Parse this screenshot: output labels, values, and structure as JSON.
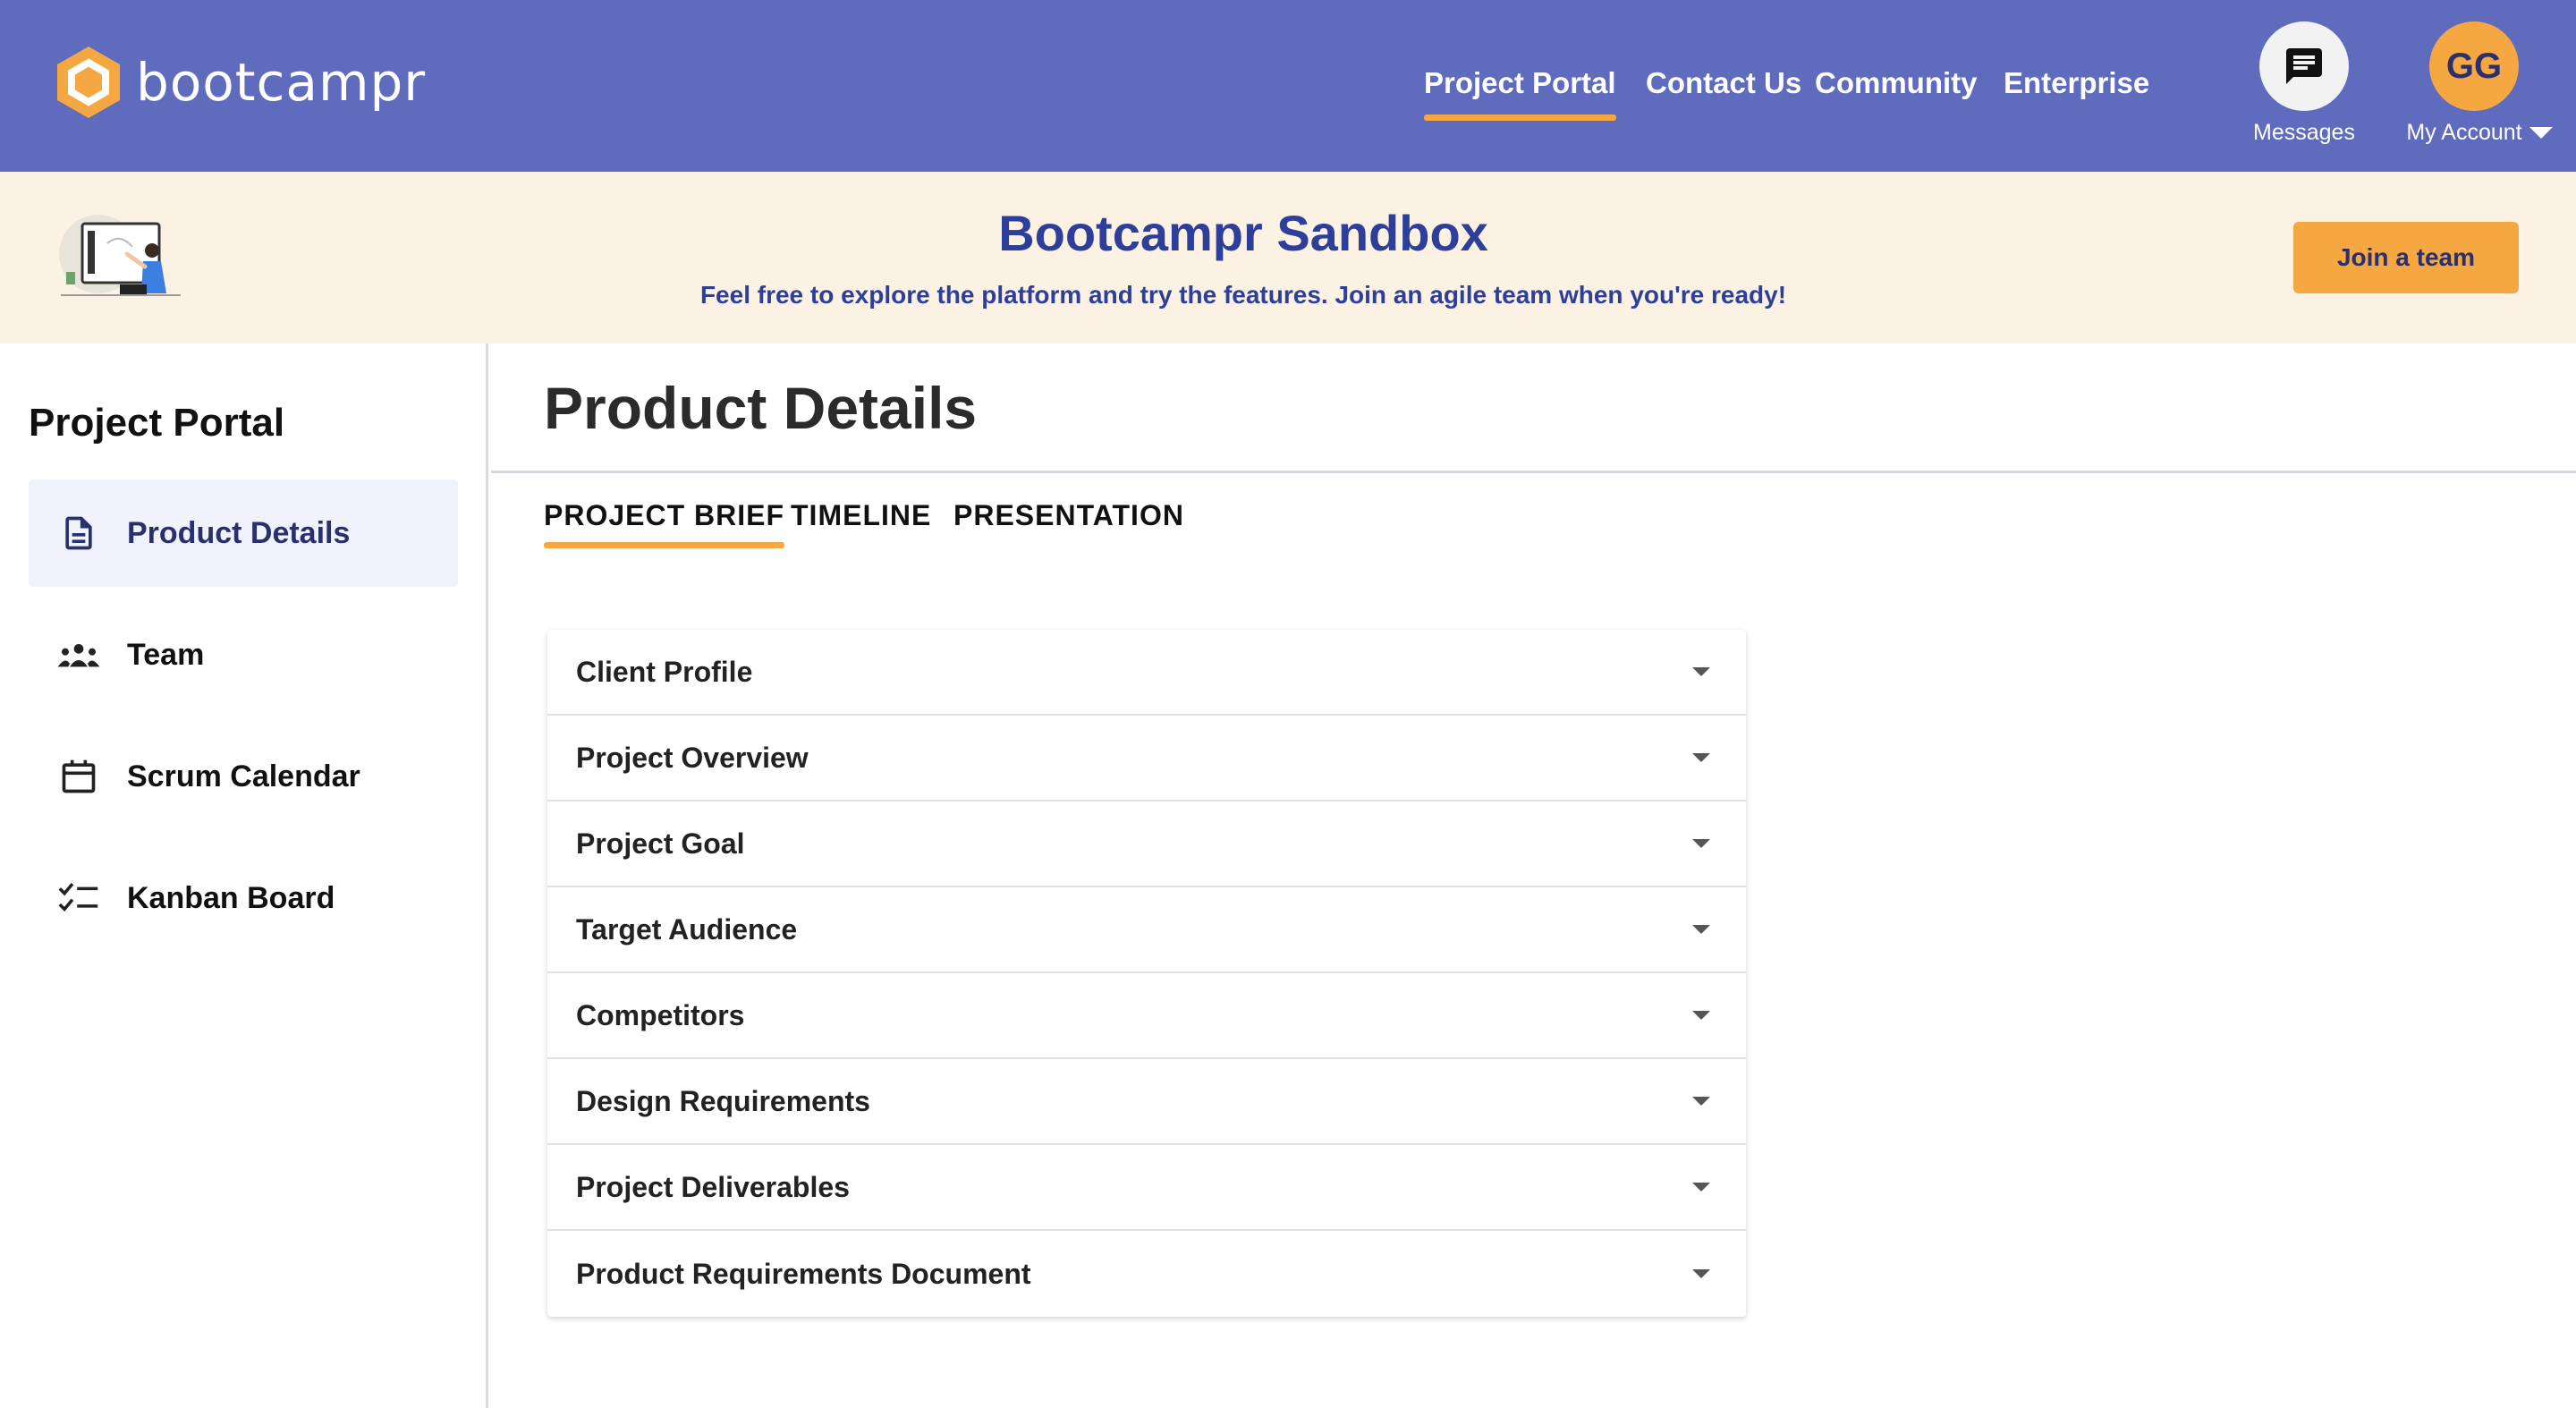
{
  "brand": {
    "name": "bootcampr",
    "logo_color": "#f5a742"
  },
  "nav": {
    "items": [
      {
        "label": "Project Portal",
        "active": true
      },
      {
        "label": "Contact Us",
        "active": false
      },
      {
        "label": "Community",
        "active": false
      },
      {
        "label": "Enterprise",
        "active": false
      }
    ],
    "messages_label": "Messages",
    "account_initials": "GG",
    "account_label": "My Account"
  },
  "banner": {
    "title": "Bootcampr Sandbox",
    "subtitle": "Feel free to explore the platform and try the features. Join an agile team when you're ready!",
    "join_button": "Join a team"
  },
  "sidebar": {
    "title": "Project Portal",
    "items": [
      {
        "label": "Product Details",
        "icon": "document-icon",
        "active": true
      },
      {
        "label": "Team",
        "icon": "team-icon",
        "active": false
      },
      {
        "label": "Scrum Calendar",
        "icon": "calendar-icon",
        "active": false
      },
      {
        "label": "Kanban Board",
        "icon": "checklist-icon",
        "active": false
      }
    ]
  },
  "main": {
    "title": "Product Details",
    "tabs": [
      {
        "label": "PROJECT BRIEF",
        "active": true
      },
      {
        "label": "TIMELINE",
        "active": false
      },
      {
        "label": "PRESENTATION",
        "active": false
      }
    ],
    "sections": [
      "Client Profile",
      "Project Overview",
      "Project Goal",
      "Target Audience",
      "Competitors",
      "Design Requirements",
      "Project Deliverables",
      "Product Requirements Document"
    ]
  },
  "colors": {
    "header_bg": "#5f6bbd",
    "accent": "#f5a742",
    "banner_bg": "#fcf2e3",
    "banner_text": "#2d3f99",
    "active_bg": "#f1f3fc"
  }
}
